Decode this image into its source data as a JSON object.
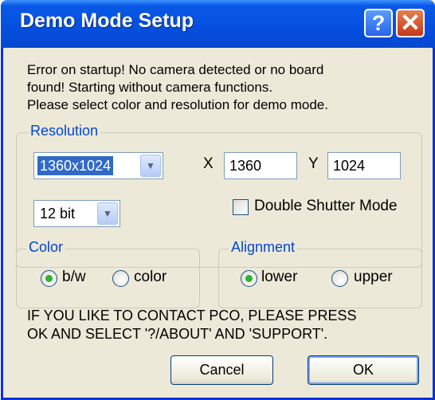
{
  "window": {
    "title": "Demo Mode Setup",
    "help_glyph": "?",
    "close_glyph": "✕"
  },
  "message": {
    "line1": "Error on startup! No camera detected or no board",
    "line2": "found! Starting without camera functions.",
    "line3": "Please select color and resolution for demo mode."
  },
  "resolution": {
    "group_label": "Resolution",
    "combo_value": "1360x1024",
    "x_label": "X",
    "x_value": "1360",
    "y_label": "Y",
    "y_value": "1024",
    "bit_value": "12 bit",
    "double_shutter_label": "Double Shutter Mode",
    "double_shutter_checked": false
  },
  "color": {
    "group_label": "Color",
    "option_bw": "b/w",
    "option_color": "color",
    "selected": "b/w"
  },
  "alignment": {
    "group_label": "Alignment",
    "option_lower": "lower",
    "option_upper": "upper",
    "selected": "lower"
  },
  "contact": {
    "line1": "IF YOU LIKE TO CONTACT PCO, PLEASE PRESS",
    "line2": "OK AND SELECT '?/ABOUT' AND 'SUPPORT'."
  },
  "buttons": {
    "cancel": "Cancel",
    "ok": "OK"
  },
  "colors": {
    "titlebar": "#0550e0",
    "dialog_bg": "#ece9d8",
    "group_label": "#0046d5",
    "selection": "#316ac5"
  }
}
